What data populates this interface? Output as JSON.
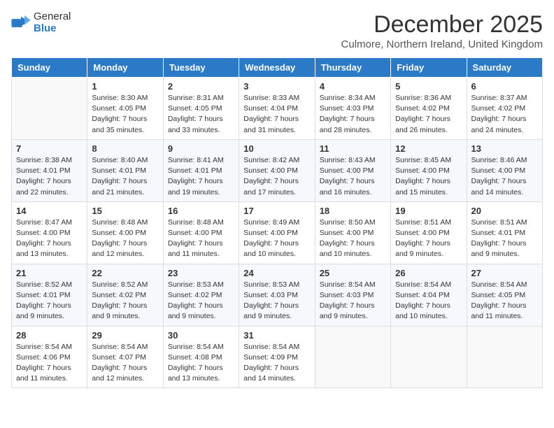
{
  "header": {
    "logo_general": "General",
    "logo_blue": "Blue",
    "month_title": "December 2025",
    "subtitle": "Culmore, Northern Ireland, United Kingdom"
  },
  "weekdays": [
    "Sunday",
    "Monday",
    "Tuesday",
    "Wednesday",
    "Thursday",
    "Friday",
    "Saturday"
  ],
  "weeks": [
    [
      {
        "day": "",
        "sunrise": "",
        "sunset": "",
        "daylight": ""
      },
      {
        "day": "1",
        "sunrise": "Sunrise: 8:30 AM",
        "sunset": "Sunset: 4:05 PM",
        "daylight": "Daylight: 7 hours and 35 minutes."
      },
      {
        "day": "2",
        "sunrise": "Sunrise: 8:31 AM",
        "sunset": "Sunset: 4:05 PM",
        "daylight": "Daylight: 7 hours and 33 minutes."
      },
      {
        "day": "3",
        "sunrise": "Sunrise: 8:33 AM",
        "sunset": "Sunset: 4:04 PM",
        "daylight": "Daylight: 7 hours and 31 minutes."
      },
      {
        "day": "4",
        "sunrise": "Sunrise: 8:34 AM",
        "sunset": "Sunset: 4:03 PM",
        "daylight": "Daylight: 7 hours and 28 minutes."
      },
      {
        "day": "5",
        "sunrise": "Sunrise: 8:36 AM",
        "sunset": "Sunset: 4:02 PM",
        "daylight": "Daylight: 7 hours and 26 minutes."
      },
      {
        "day": "6",
        "sunrise": "Sunrise: 8:37 AM",
        "sunset": "Sunset: 4:02 PM",
        "daylight": "Daylight: 7 hours and 24 minutes."
      }
    ],
    [
      {
        "day": "7",
        "sunrise": "Sunrise: 8:38 AM",
        "sunset": "Sunset: 4:01 PM",
        "daylight": "Daylight: 7 hours and 22 minutes."
      },
      {
        "day": "8",
        "sunrise": "Sunrise: 8:40 AM",
        "sunset": "Sunset: 4:01 PM",
        "daylight": "Daylight: 7 hours and 21 minutes."
      },
      {
        "day": "9",
        "sunrise": "Sunrise: 8:41 AM",
        "sunset": "Sunset: 4:01 PM",
        "daylight": "Daylight: 7 hours and 19 minutes."
      },
      {
        "day": "10",
        "sunrise": "Sunrise: 8:42 AM",
        "sunset": "Sunset: 4:00 PM",
        "daylight": "Daylight: 7 hours and 17 minutes."
      },
      {
        "day": "11",
        "sunrise": "Sunrise: 8:43 AM",
        "sunset": "Sunset: 4:00 PM",
        "daylight": "Daylight: 7 hours and 16 minutes."
      },
      {
        "day": "12",
        "sunrise": "Sunrise: 8:45 AM",
        "sunset": "Sunset: 4:00 PM",
        "daylight": "Daylight: 7 hours and 15 minutes."
      },
      {
        "day": "13",
        "sunrise": "Sunrise: 8:46 AM",
        "sunset": "Sunset: 4:00 PM",
        "daylight": "Daylight: 7 hours and 14 minutes."
      }
    ],
    [
      {
        "day": "14",
        "sunrise": "Sunrise: 8:47 AM",
        "sunset": "Sunset: 4:00 PM",
        "daylight": "Daylight: 7 hours and 13 minutes."
      },
      {
        "day": "15",
        "sunrise": "Sunrise: 8:48 AM",
        "sunset": "Sunset: 4:00 PM",
        "daylight": "Daylight: 7 hours and 12 minutes."
      },
      {
        "day": "16",
        "sunrise": "Sunrise: 8:48 AM",
        "sunset": "Sunset: 4:00 PM",
        "daylight": "Daylight: 7 hours and 11 minutes."
      },
      {
        "day": "17",
        "sunrise": "Sunrise: 8:49 AM",
        "sunset": "Sunset: 4:00 PM",
        "daylight": "Daylight: 7 hours and 10 minutes."
      },
      {
        "day": "18",
        "sunrise": "Sunrise: 8:50 AM",
        "sunset": "Sunset: 4:00 PM",
        "daylight": "Daylight: 7 hours and 10 minutes."
      },
      {
        "day": "19",
        "sunrise": "Sunrise: 8:51 AM",
        "sunset": "Sunset: 4:00 PM",
        "daylight": "Daylight: 7 hours and 9 minutes."
      },
      {
        "day": "20",
        "sunrise": "Sunrise: 8:51 AM",
        "sunset": "Sunset: 4:01 PM",
        "daylight": "Daylight: 7 hours and 9 minutes."
      }
    ],
    [
      {
        "day": "21",
        "sunrise": "Sunrise: 8:52 AM",
        "sunset": "Sunset: 4:01 PM",
        "daylight": "Daylight: 7 hours and 9 minutes."
      },
      {
        "day": "22",
        "sunrise": "Sunrise: 8:52 AM",
        "sunset": "Sunset: 4:02 PM",
        "daylight": "Daylight: 7 hours and 9 minutes."
      },
      {
        "day": "23",
        "sunrise": "Sunrise: 8:53 AM",
        "sunset": "Sunset: 4:02 PM",
        "daylight": "Daylight: 7 hours and 9 minutes."
      },
      {
        "day": "24",
        "sunrise": "Sunrise: 8:53 AM",
        "sunset": "Sunset: 4:03 PM",
        "daylight": "Daylight: 7 hours and 9 minutes."
      },
      {
        "day": "25",
        "sunrise": "Sunrise: 8:54 AM",
        "sunset": "Sunset: 4:03 PM",
        "daylight": "Daylight: 7 hours and 9 minutes."
      },
      {
        "day": "26",
        "sunrise": "Sunrise: 8:54 AM",
        "sunset": "Sunset: 4:04 PM",
        "daylight": "Daylight: 7 hours and 10 minutes."
      },
      {
        "day": "27",
        "sunrise": "Sunrise: 8:54 AM",
        "sunset": "Sunset: 4:05 PM",
        "daylight": "Daylight: 7 hours and 11 minutes."
      }
    ],
    [
      {
        "day": "28",
        "sunrise": "Sunrise: 8:54 AM",
        "sunset": "Sunset: 4:06 PM",
        "daylight": "Daylight: 7 hours and 11 minutes."
      },
      {
        "day": "29",
        "sunrise": "Sunrise: 8:54 AM",
        "sunset": "Sunset: 4:07 PM",
        "daylight": "Daylight: 7 hours and 12 minutes."
      },
      {
        "day": "30",
        "sunrise": "Sunrise: 8:54 AM",
        "sunset": "Sunset: 4:08 PM",
        "daylight": "Daylight: 7 hours and 13 minutes."
      },
      {
        "day": "31",
        "sunrise": "Sunrise: 8:54 AM",
        "sunset": "Sunset: 4:09 PM",
        "daylight": "Daylight: 7 hours and 14 minutes."
      },
      {
        "day": "",
        "sunrise": "",
        "sunset": "",
        "daylight": ""
      },
      {
        "day": "",
        "sunrise": "",
        "sunset": "",
        "daylight": ""
      },
      {
        "day": "",
        "sunrise": "",
        "sunset": "",
        "daylight": ""
      }
    ]
  ]
}
